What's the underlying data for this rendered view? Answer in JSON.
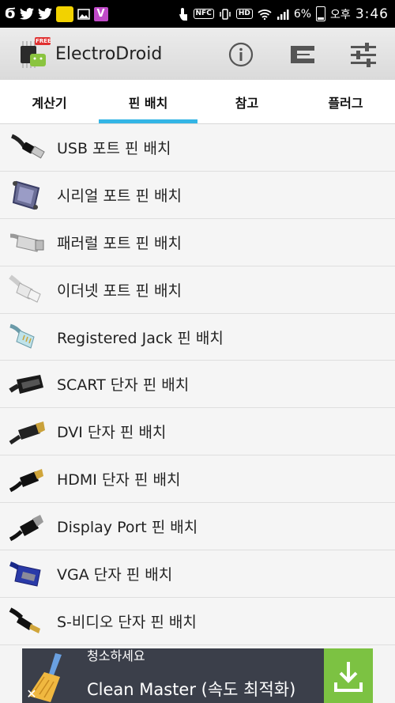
{
  "status_bar": {
    "battery": "6%",
    "nfc": "NFC",
    "hd": "HD",
    "ampm": "오후",
    "time": "3:46",
    "app_badge": "V"
  },
  "app": {
    "title": "ElectroDroid",
    "free_badge": "FREE"
  },
  "tabs": [
    {
      "label": "계산기",
      "active": false
    },
    {
      "label": "핀 배치",
      "active": true
    },
    {
      "label": "참고",
      "active": false
    },
    {
      "label": "플러그",
      "active": false
    }
  ],
  "items": [
    {
      "label": "USB 포트 핀 배치",
      "icon": "usb-cable-icon"
    },
    {
      "label": "시리얼 포트 핀 배치",
      "icon": "serial-connector-icon"
    },
    {
      "label": "패러럴 포트 핀 배치",
      "icon": "parallel-cable-icon"
    },
    {
      "label": "이더넷 포트 핀 배치",
      "icon": "ethernet-plug-icon"
    },
    {
      "label": "Registered Jack 핀 배치",
      "icon": "rj-plug-icon"
    },
    {
      "label": "SCART 단자 핀 배치",
      "icon": "scart-plug-icon"
    },
    {
      "label": "DVI 단자 핀 배치",
      "icon": "dvi-plug-icon"
    },
    {
      "label": "HDMI 단자 핀 배치",
      "icon": "hdmi-plug-icon"
    },
    {
      "label": "Display Port 핀 배치",
      "icon": "displayport-plug-icon"
    },
    {
      "label": "VGA 단자 핀 배치",
      "icon": "vga-plug-icon"
    },
    {
      "label": "S-비디오 단자 핀 배치",
      "icon": "svideo-plug-icon"
    }
  ],
  "ad": {
    "line1": "청소하세요",
    "line2": "Clean Master (속도 최적화)"
  },
  "colors": {
    "accent": "#33b5e5",
    "download": "#7cc242"
  }
}
